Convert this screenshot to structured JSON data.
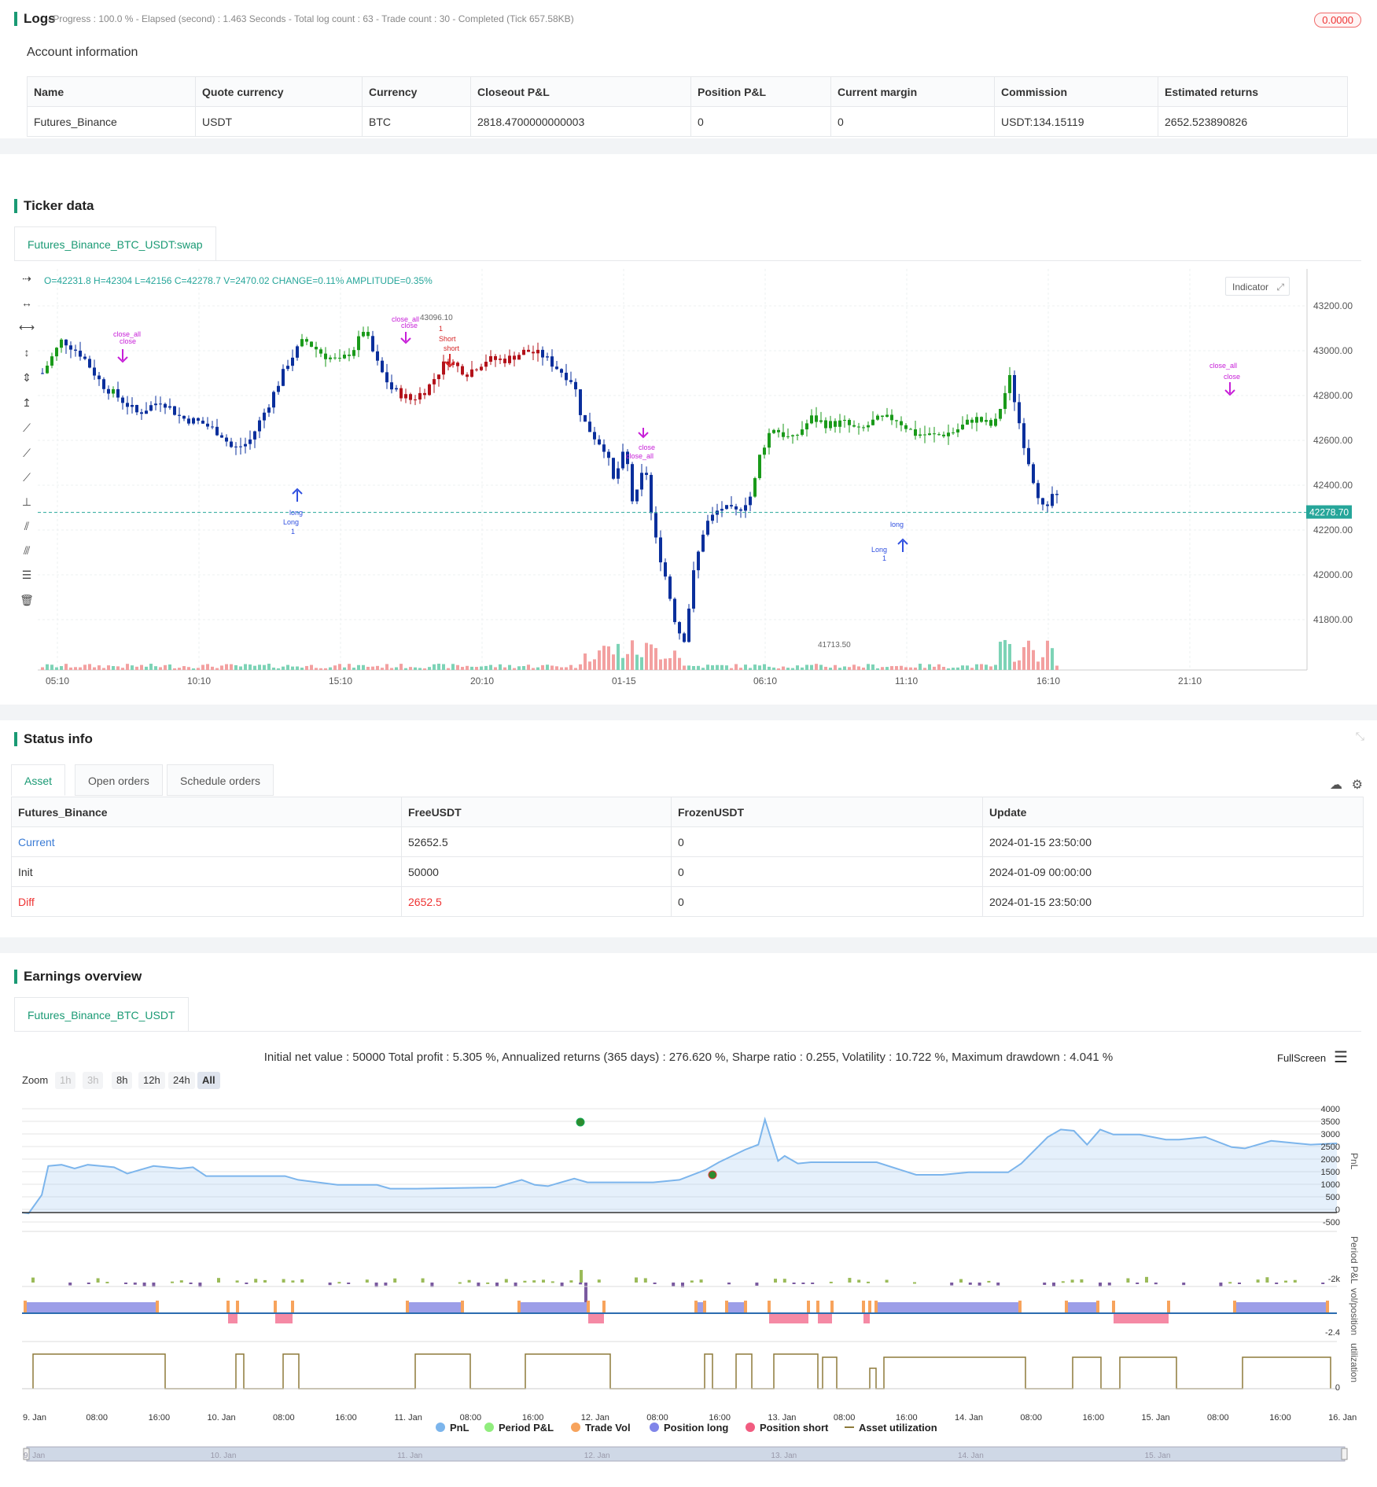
{
  "logs": {
    "title": "Logs",
    "status": "- Progress : 100.0 % - Elapsed (second) : 1.463 Seconds - Total log count : 63 - Trade count : 30 - Completed (Tick 657.58KB)",
    "badge": "0.0000"
  },
  "account": {
    "title": "Account information",
    "headers": [
      "Name",
      "Quote currency",
      "Currency",
      "Closeout P&L",
      "Position P&L",
      "Current margin",
      "Commission",
      "Estimated returns"
    ],
    "row": [
      "Futures_Binance",
      "USDT",
      "BTC",
      "2818.4700000000003",
      "0",
      "0",
      "USDT:134.15119",
      "2652.523890826"
    ]
  },
  "ticker": {
    "title": "Ticker data",
    "tab": "Futures_Binance_BTC_USDT:swap",
    "ohlc": "O=42231.8 H=42304 L=42156 C=42278.7 V=2470.02 CHANGE=0.11% AMPLITUDE=0.35%",
    "indicator_label": "Indicator",
    "price_tag": "42278.70",
    "high_label": "43096.10",
    "low_label": "41713.50",
    "y_ticks": [
      "43200.00",
      "43000.00",
      "42800.00",
      "42600.00",
      "42400.00",
      "42200.00",
      "42000.00",
      "41800.00"
    ],
    "x_ticks": [
      "05:10",
      "10:10",
      "15:10",
      "20:10",
      "01-15",
      "06:10",
      "11:10",
      "16:10",
      "21:10"
    ],
    "markers": {
      "close_all_1": "close_all",
      "close_1": "close",
      "close_all_2": "close_all",
      "close_2": "close",
      "short_label": "Short",
      "short_small": "short",
      "one_1": "1",
      "long_label": "Long",
      "long_small": "long",
      "one_2": "1",
      "close_3": "close",
      "close_all_3": "close_all",
      "long_label_2": "Long",
      "long_small_2": "long",
      "one_3": "1",
      "close_all_4": "close_all",
      "close_4": "close"
    }
  },
  "status": {
    "title": "Status info",
    "tabs": [
      "Asset",
      "Open orders",
      "Schedule orders"
    ],
    "headers": [
      "Futures_Binance",
      "FreeUSDT",
      "FrozenUSDT",
      "Update"
    ],
    "rows": [
      [
        "Current",
        "52652.5",
        "0",
        "2024-01-15 23:50:00"
      ],
      [
        "Init",
        "50000",
        "0",
        "2024-01-09 00:00:00"
      ],
      [
        "Diff",
        "2652.5",
        "0",
        "2024-01-15 23:50:00"
      ]
    ],
    "colors": {
      "current": "#3a7bd5",
      "diff": "#e33"
    }
  },
  "earnings": {
    "title": "Earnings overview",
    "tab": "Futures_Binance_BTC_USDT",
    "summary": "Initial net value : 50000 Total profit : 5.305 %, Annualized returns (365 days) : 276.620 %, Sharpe ratio : 0.255, Volatility : 10.722 %, Maximum drawdown : 4.041 %",
    "fullscreen": "FullScreen",
    "zoom_label": "Zoom",
    "zoom_buttons": [
      "1h",
      "3h",
      "8h",
      "12h",
      "24h",
      "All"
    ],
    "pnl_ticks": [
      "4000",
      "3500",
      "3000",
      "2500",
      "2000",
      "1500",
      "1000",
      "500",
      "0",
      "-500"
    ],
    "pnl_axis": "PnL",
    "period_axis": "Period P&L",
    "period_tick": "-2k",
    "vol_axis": "vol/position",
    "vol_tick": "-2.4",
    "util_axis": "utilization",
    "util_tick": "0",
    "x_ticks": [
      "9. Jan",
      "08:00",
      "16:00",
      "10. Jan",
      "08:00",
      "16:00",
      "11. Jan",
      "08:00",
      "16:00",
      "12. Jan",
      "08:00",
      "16:00",
      "13. Jan",
      "08:00",
      "16:00",
      "14. Jan",
      "08:00",
      "16:00",
      "15. Jan",
      "08:00",
      "16:00",
      "16. Jan"
    ],
    "nav_ticks": [
      "9. Jan",
      "10. Jan",
      "11. Jan",
      "12. Jan",
      "13. Jan",
      "14. Jan",
      "15. Jan"
    ],
    "legend": [
      {
        "label": "PnL",
        "color": "#7cb5ec"
      },
      {
        "label": "Period P&L",
        "color": "#90ed7d"
      },
      {
        "label": "Trade Vol",
        "color": "#f7a35c"
      },
      {
        "label": "Position long",
        "color": "#8085e9"
      },
      {
        "label": "Position short",
        "color": "#f15c80"
      },
      {
        "label": "Asset utilization",
        "color": "#8d7a3a"
      }
    ]
  }
}
